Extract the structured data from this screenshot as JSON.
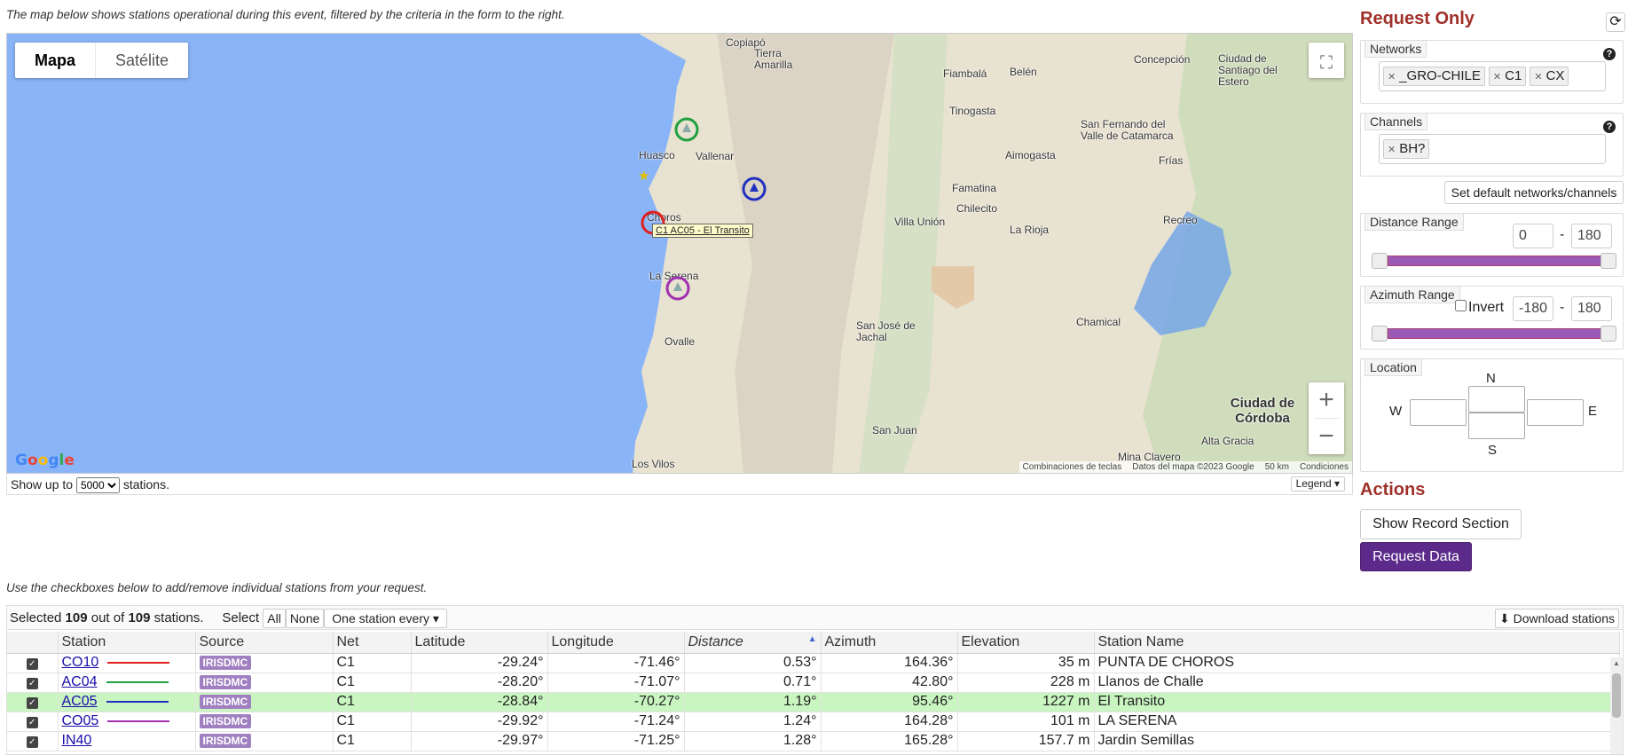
{
  "intro_text": "The map below shows stations operational during this event, filtered by the criteria in the form to the right.",
  "map": {
    "map_type_options": [
      "Mapa",
      "Satélite"
    ],
    "tooltip": "C1 AC05 - El Transito",
    "places": [
      {
        "name": "Copiapó",
        "big": false
      },
      {
        "name": "Tierra Amarilla",
        "big": false
      },
      {
        "name": "Fiambalá",
        "big": false
      },
      {
        "name": "Belén",
        "big": false
      },
      {
        "name": "Concepción",
        "big": false
      },
      {
        "name": "Ciudad de Santiago del Estero",
        "big": false
      },
      {
        "name": "Tinogasta",
        "big": false
      },
      {
        "name": "Huasco",
        "big": false
      },
      {
        "name": "Vallenar",
        "big": false
      },
      {
        "name": "San Fernando del Valle de Catamarca",
        "big": false
      },
      {
        "name": "Aimogasta",
        "big": false
      },
      {
        "name": "Frías",
        "big": false
      },
      {
        "name": "Famatina",
        "big": false
      },
      {
        "name": "Chilecito",
        "big": false
      },
      {
        "name": "Choros",
        "big": false
      },
      {
        "name": "Villa Unión",
        "big": false
      },
      {
        "name": "La Rioja",
        "big": false
      },
      {
        "name": "Recreo",
        "big": false
      },
      {
        "name": "La Serena",
        "big": false
      },
      {
        "name": "Ovalle",
        "big": false
      },
      {
        "name": "San José de Jachal",
        "big": false
      },
      {
        "name": "Chamical",
        "big": false
      },
      {
        "name": "San Juan",
        "big": false
      },
      {
        "name": "Ciudad de Córdoba",
        "big": true
      },
      {
        "name": "Alta Gracia",
        "big": false
      },
      {
        "name": "Mina Clavero",
        "big": false
      },
      {
        "name": "Los Vilos",
        "big": false
      }
    ],
    "attribution": [
      "Combinaciones de teclas",
      "Datos del mapa ©2023 Google",
      "50 km",
      "Condiciones"
    ],
    "logo": "Google"
  },
  "map_footer": {
    "show_up_to": "Show up to",
    "limit_value": "5000",
    "stations_suffix": "stations.",
    "legend_button": "Legend ▾"
  },
  "panel": {
    "title": "Request Only",
    "networks_label": "Networks",
    "networks": [
      "_GRO-CHILE",
      "C1",
      "CX"
    ],
    "channels_label": "Channels",
    "channels": [
      "BH?"
    ],
    "set_default_button": "Set default networks/channels",
    "distance_label": "Distance Range",
    "distance_min": "0",
    "distance_max": "180",
    "azimuth_label": "Azimuth Range",
    "invert_label": "Invert",
    "azimuth_min": "-180",
    "azimuth_max": "180",
    "location_label": "Location",
    "n": "N",
    "s": "S",
    "w": "W",
    "e": "E",
    "actions_title": "Actions",
    "record_section_button": "Show Record Section",
    "request_data_button": "Request Data",
    "help": "?",
    "dash": "-"
  },
  "table_intro": "Use the checkboxes below to add/remove individual stations from your request.",
  "table": {
    "selected_prefix": "Selected",
    "selected_count": "109",
    "out_of": "out of",
    "total_count": "109",
    "stations_word": "stations.",
    "select_label": "Select",
    "all_button": "All",
    "none_button": "None",
    "every_button": "One station every ▾",
    "download_button": "Download stations",
    "columns": [
      "",
      "Station",
      "Source",
      "Net",
      "Latitude",
      "Longitude",
      "Distance",
      "Azimuth",
      "Elevation",
      "Station Name"
    ],
    "rows": [
      {
        "station": "CO10",
        "line_color": "#e02020",
        "source": "IRISDMC",
        "net": "C1",
        "lat": "-29.24°",
        "lon": "-71.46°",
        "dist": "0.53°",
        "az": "164.36°",
        "elev": "35 m",
        "name": "PUNTA DE CHOROS"
      },
      {
        "station": "AC04",
        "line_color": "#20a040",
        "source": "IRISDMC",
        "net": "C1",
        "lat": "-28.20°",
        "lon": "-71.07°",
        "dist": "0.71°",
        "az": "42.80°",
        "elev": "228 m",
        "name": "Llanos de Challe"
      },
      {
        "station": "AC05",
        "line_color": "#2030c0",
        "source": "IRISDMC",
        "net": "C1",
        "lat": "-28.84°",
        "lon": "-70.27°",
        "dist": "1.19°",
        "az": "95.46°",
        "elev": "1227 m",
        "name": "El Transito"
      },
      {
        "station": "CO05",
        "line_color": "#a030b0",
        "source": "IRISDMC",
        "net": "C1",
        "lat": "-29.92°",
        "lon": "-71.24°",
        "dist": "1.24°",
        "az": "164.28°",
        "elev": "101 m",
        "name": "LA SERENA"
      },
      {
        "station": "IN40",
        "line_color": "",
        "source": "IRISDMC",
        "net": "C1",
        "lat": "-29.97°",
        "lon": "-71.25°",
        "dist": "1.28°",
        "az": "165.28°",
        "elev": "157.7 m",
        "name": "Jardin Semillas"
      }
    ]
  },
  "colors": {
    "accent_title": "#a0302a",
    "request_button": "#5b2a8a",
    "slider": "#9b59b6",
    "highlight_row": "#c9f5c0"
  }
}
